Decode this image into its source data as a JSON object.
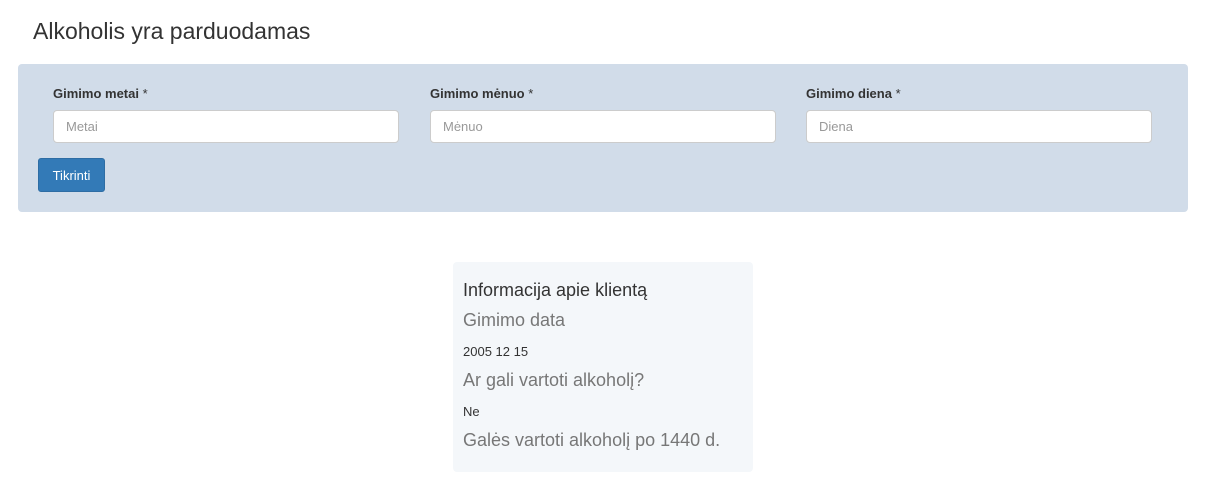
{
  "page": {
    "title": "Alkoholis yra parduodamas"
  },
  "form": {
    "fields": [
      {
        "label": "Gimimo metai",
        "required_mark": "*",
        "placeholder": "Metai",
        "value": ""
      },
      {
        "label": "Gimimo mėnuo",
        "required_mark": "*",
        "placeholder": "Mėnuo",
        "value": ""
      },
      {
        "label": "Gimimo diena",
        "required_mark": "*",
        "placeholder": "Diena",
        "value": ""
      }
    ],
    "submit_label": "Tikrinti"
  },
  "info": {
    "title": "Informacija apie klientą",
    "birth_date_heading": "Gimimo data",
    "birth_date_value": "2005 12 15",
    "can_drink_heading": "Ar gali vartoti alkoholį?",
    "can_drink_value": "Ne",
    "days_until_text": "Galės vartoti alkoholį po 1440 d."
  },
  "colors": {
    "panel_background": "#d1dce9",
    "primary_button": "#337ab7",
    "card_background": "#f4f7fa"
  }
}
